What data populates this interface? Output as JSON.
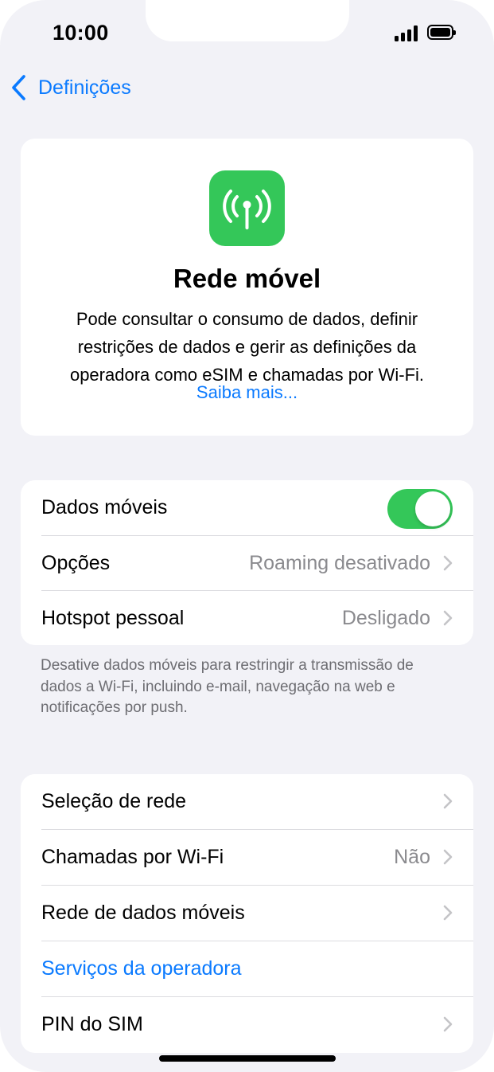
{
  "status_bar": {
    "time": "10:00"
  },
  "nav": {
    "back_label": "Definições"
  },
  "hero": {
    "icon": "cellular-antenna-icon",
    "title": "Rede móvel",
    "description": "Pode consultar o consumo de dados, definir restrições de dados e gerir as definições da operadora como eSIM e chamadas por Wi-Fi.",
    "link": "Saiba mais..."
  },
  "group1": {
    "items": [
      {
        "label": "Dados móveis",
        "toggle_on": true
      },
      {
        "label": "Opções",
        "value": "Roaming desativado"
      },
      {
        "label": "Hotspot pessoal",
        "value": "Desligado"
      }
    ],
    "footnote": "Desative dados móveis para restringir a transmissão de dados a Wi-Fi, incluindo e-mail, navegação na web e notificações por push."
  },
  "group2": {
    "items": [
      {
        "label": "Seleção de rede"
      },
      {
        "label": "Chamadas por Wi-Fi",
        "value": "Não"
      },
      {
        "label": "Rede de dados móveis"
      },
      {
        "label": "Serviços da operadora"
      },
      {
        "label": "PIN do SIM"
      }
    ]
  },
  "colors": {
    "accent": "#0a7aff",
    "toggle_on": "#34c759",
    "background": "#f2f2f7"
  }
}
